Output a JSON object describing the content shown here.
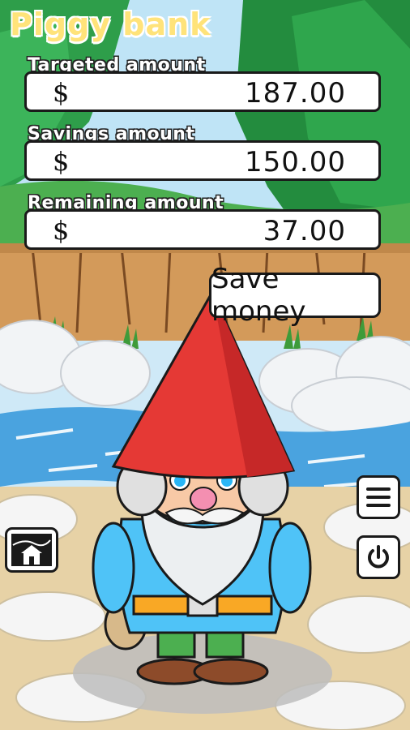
{
  "app": {
    "title": "Piggy bank"
  },
  "fields": [
    {
      "label": "Targeted amount",
      "currency": "$",
      "value": "187.00"
    },
    {
      "label": "Savings amount",
      "currency": "$",
      "value": "150.00"
    },
    {
      "label": "Remaining amount",
      "currency": "$",
      "value": "37.00"
    }
  ],
  "actions": {
    "save_label": "Save money"
  },
  "icons": {
    "home": "home-icon",
    "menu": "menu-icon",
    "power": "power-icon"
  },
  "colors": {
    "title": "#ffe37a",
    "hat": "#e53935",
    "shirt": "#4fc3f7",
    "belt": "#f9a825"
  }
}
